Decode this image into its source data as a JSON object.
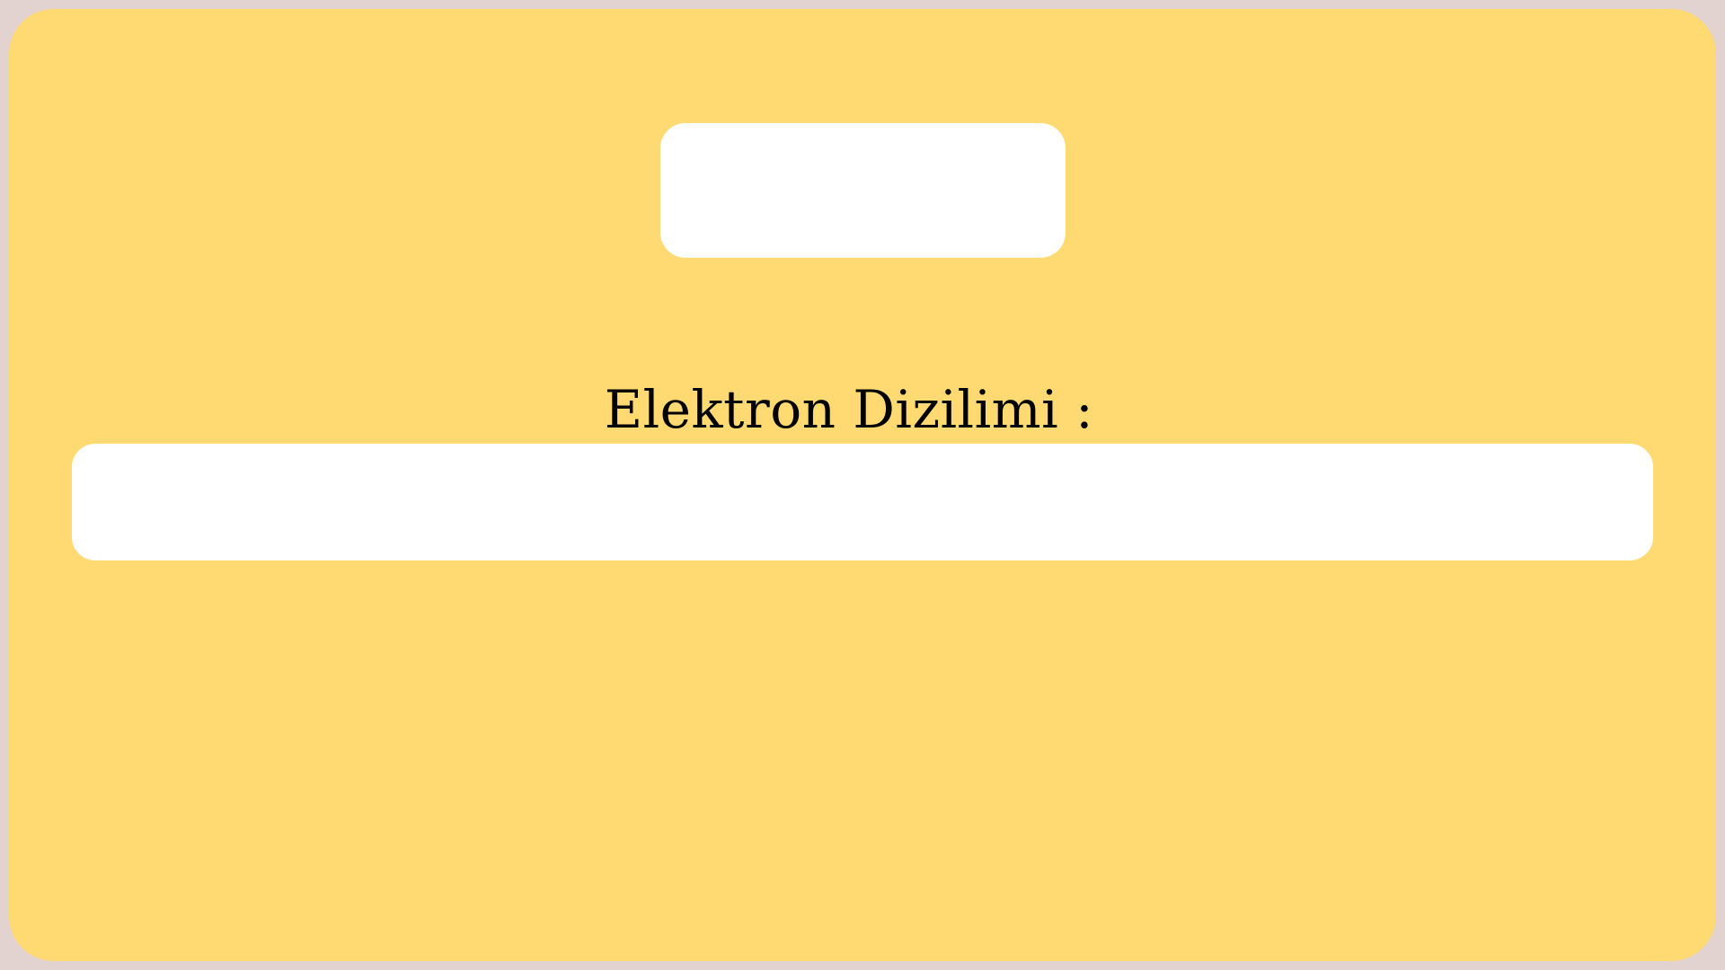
{
  "colors": {
    "page_background": "#e2d3d1",
    "card_background": "#ffd972",
    "box_background": "#ffffff",
    "text": "#000000"
  },
  "top_box": {
    "value": ""
  },
  "electron_configuration": {
    "label": "Elektron Dizilimi :",
    "value": ""
  }
}
